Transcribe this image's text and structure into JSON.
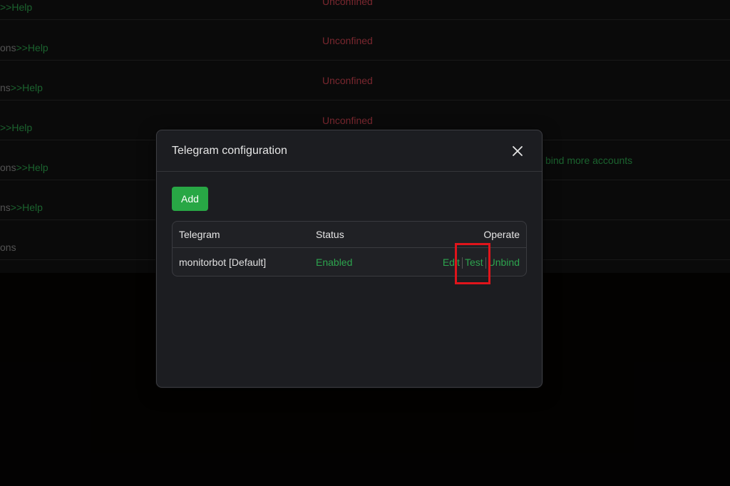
{
  "background": {
    "rows": [
      {
        "left": "",
        "help": ">>Help",
        "mid": "Unconfined",
        "right": ""
      },
      {
        "left": "ons",
        "help": ">>Help",
        "mid": "Unconfined",
        "right": ""
      },
      {
        "left": "ns",
        "help": ">>Help",
        "mid": "Unconfined",
        "right": ""
      },
      {
        "left": "",
        "help": ">>Help",
        "mid": "Unconfined",
        "right": ""
      },
      {
        "left": "ons",
        "help": ">>Help",
        "mid": "",
        "right": "bind more accounts"
      },
      {
        "left": "ns",
        "help": ">>Help",
        "mid": "",
        "right": ""
      },
      {
        "left": "ons",
        "help": "",
        "mid": "",
        "right": ""
      }
    ]
  },
  "modal": {
    "title": "Telegram configuration",
    "close_icon": "close-icon",
    "add_label": "Add",
    "table": {
      "headers": {
        "name": "Telegram",
        "status": "Status",
        "operate": "Operate"
      },
      "rows": [
        {
          "name": "monitorbot [Default]",
          "status": "Enabled",
          "ops": {
            "edit": "Edit",
            "test": "Test",
            "unbind": "Unbind"
          }
        }
      ]
    }
  },
  "colors": {
    "accent_green": "#28a745",
    "link_green": "#2da44e",
    "error_red": "#c9404d",
    "highlight_red": "#e0141b"
  }
}
